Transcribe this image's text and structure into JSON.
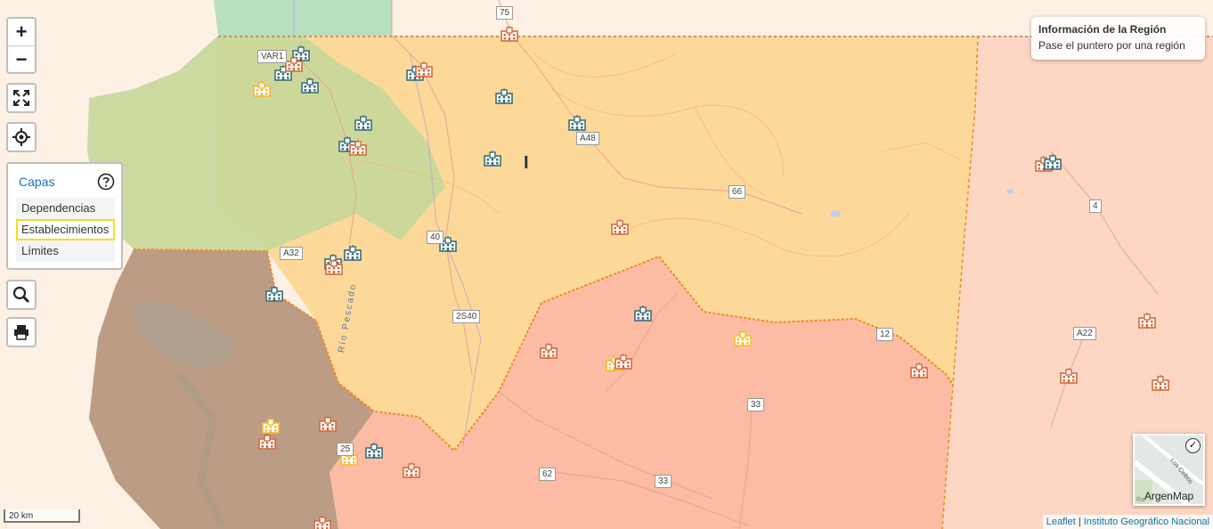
{
  "controls": {
    "zoom_in": "+",
    "zoom_out": "−",
    "fullscreen_icon": "fullscreen-icon",
    "locate_icon": "locate-icon",
    "search_icon": "search-icon",
    "print_icon": "print-icon"
  },
  "layers": {
    "title": "Capas",
    "help_icon": "help-icon",
    "items": [
      "Dependencias",
      "Establecimientos",
      "Límites"
    ],
    "selected": "Establecimientos"
  },
  "info_panel": {
    "title": "Información de la Región",
    "subtitle": "Pase el puntero por una región"
  },
  "region_label": "I",
  "road_labels": [
    "75",
    "VAR1",
    "A48",
    "66",
    "4",
    "40",
    "A32",
    "2S40",
    "12",
    "A22",
    "33",
    "25",
    "62",
    "33"
  ],
  "river_label": "Río Pescado",
  "minimap": {
    "label": "ArgenMap",
    "street": "Los Ceibos",
    "fragment": "Ra"
  },
  "scale": "20 km",
  "attribution": {
    "leaflet": "Leaflet",
    "separator": "|",
    "source": "Instituto Geográfico Nacional"
  },
  "colors": {
    "region_yellow": "#fdd999",
    "region_red": "#fbbfa6",
    "region_peach": "#fdd7c4",
    "outline": "#f08a24",
    "green_region": "#b9d9a8",
    "dark_region": "#b59580",
    "school_teal": "#3a6f78",
    "school_orange": "#d4693b",
    "school_yellow": "#f5bb34"
  }
}
